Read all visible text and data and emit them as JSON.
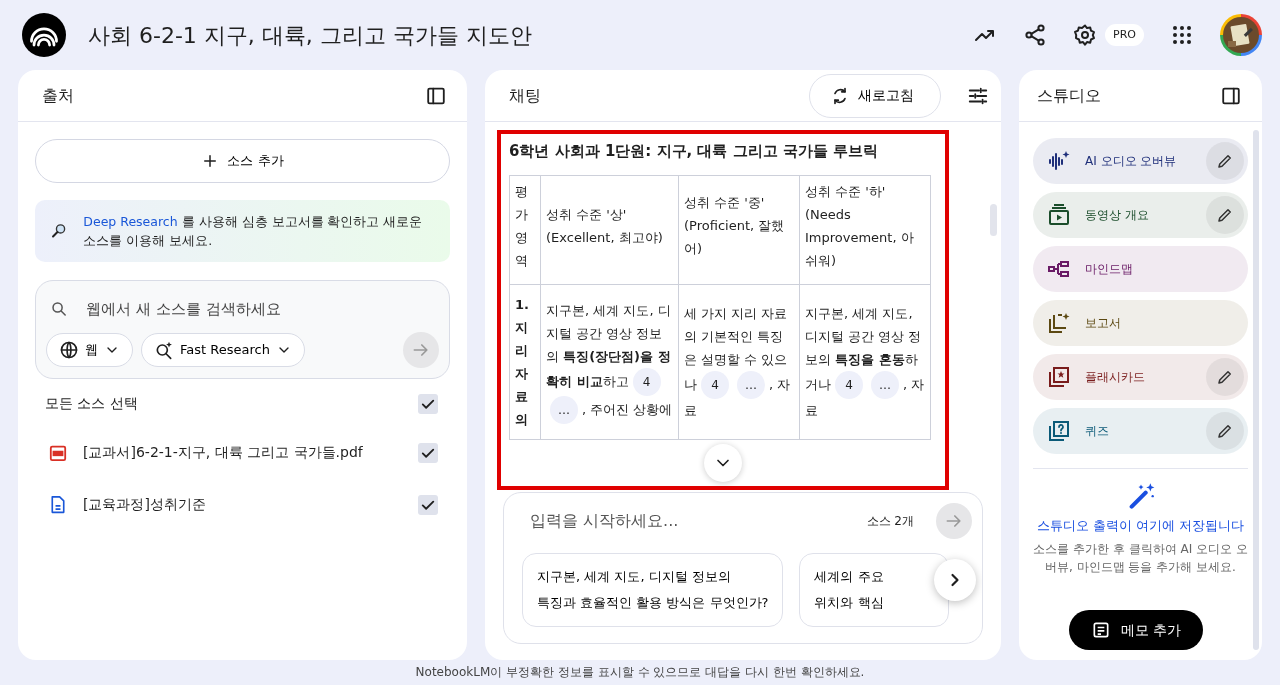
{
  "header": {
    "title": "사회 6-2-1 지구, 대륙, 그리고 국가들 지도안",
    "badge": "PRO"
  },
  "sources_panel": {
    "title": "출처",
    "add_button": "소스 추가",
    "banner": {
      "link": "Deep Research",
      "text": " 를 사용해 심층 보고서를 확인하고 새로운 소스를 이용해 보세요."
    },
    "search": {
      "placeholder": "웹에서 새 소스를 검색하세요",
      "chips": [
        {
          "kind": "web",
          "label": "웹"
        },
        {
          "kind": "research",
          "label": "Fast Research"
        }
      ]
    },
    "select_all": {
      "label": "모든 소스 선택",
      "checked": true
    },
    "sources": [
      {
        "kind": "pdf",
        "name": "[교과서]6-2-1-지구, 대륙 그리고 국가들.pdf",
        "checked": true
      },
      {
        "kind": "doc",
        "name": "[교육과정]성취기준",
        "checked": true
      }
    ]
  },
  "chat": {
    "title": "채팅",
    "refresh_button": "새로고침",
    "response_title": "6학년 사회과 1단원: 지구, 대륙 그리고 국가들 루브릭",
    "table": {
      "columns": [
        "평가영역",
        "성취 수준 '상' (Excellent, 최고야)",
        "성취 수준 '중' (Proficient, 잘했어)",
        "성취 수준 '하' (Needs Improvement, 아쉬워)"
      ],
      "rows": [
        [
          [
            {
              "kind": "text",
              "text": "**1. 지리 자료의**"
            }
          ],
          [
            {
              "kind": "text",
              "text": "지구본, 세계 지도, 디지털 공간 영상 정보의 **특징(장단점)을 정확히 비교**하고"
            },
            {
              "kind": "cite",
              "text": "4"
            },
            {
              "kind": "cite",
              "text": "…"
            },
            {
              "kind": "text",
              "text": ", 주어진 상황에"
            }
          ],
          [
            {
              "kind": "text",
              "text": "세 가지 지리 자료의 기본적인 특징은 설명할 수 있으나"
            },
            {
              "kind": "cite",
              "text": "4"
            },
            {
              "kind": "cite",
              "text": "…"
            },
            {
              "kind": "text",
              "text": ", 자료"
            }
          ],
          [
            {
              "kind": "text",
              "text": "지구본, 세계 지도, 디지털 공간 영상 정보의 **특징을 혼동**하거나"
            },
            {
              "kind": "cite",
              "text": "4"
            },
            {
              "kind": "cite",
              "text": "…"
            },
            {
              "kind": "text",
              "text": ", 자료"
            }
          ]
        ]
      ]
    },
    "input": {
      "placeholder": "입력을 시작하세요...",
      "source_count": "소스 2개"
    },
    "suggestions": [
      {
        "lines": [
          "지구본, 세계 지도, 디지털 정보의",
          "특징과 효율적인 활용 방식은 무엇인가?"
        ]
      },
      {
        "lines": [
          "세계의 주요",
          "위치와 핵심"
        ]
      }
    ]
  },
  "studio": {
    "title": "스튜디오",
    "tools": [
      {
        "kind": "audio",
        "label": "AI 오디오 오버뷰",
        "color": "#1f2f7a",
        "editable": true
      },
      {
        "kind": "video",
        "label": "동영상 개요",
        "color": "#1b4d2b",
        "editable": true
      },
      {
        "kind": "mindmap",
        "label": "마인드맵",
        "color": "#6a1b66",
        "editable": false
      },
      {
        "kind": "report",
        "label": "보고서",
        "color": "#5c4912",
        "editable": false
      },
      {
        "kind": "flashcards",
        "label": "플래시카드",
        "color": "#7a1c1c",
        "editable": true
      },
      {
        "kind": "quiz",
        "label": "퀴즈",
        "color": "#0b5a78",
        "editable": true
      }
    ],
    "empty_title": "스튜디오 출력이 여기에 저장됩니다",
    "empty_text": "소스를 추가한 후 클릭하여 AI 오디오 오버뷰, 마인드맵 등을 추가해 보세요.",
    "note_button": "메모 추가"
  },
  "footer": "NotebookLM이 부정확한 정보를 표시할 수 있으므로 대답을 다시 한번 확인하세요."
}
